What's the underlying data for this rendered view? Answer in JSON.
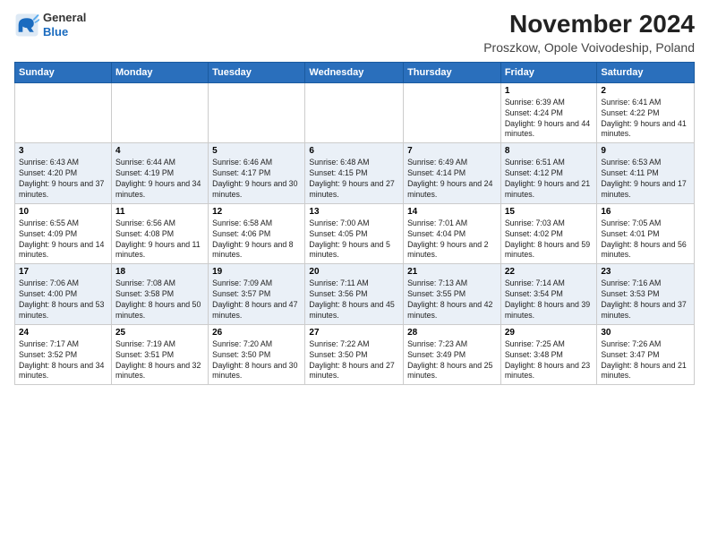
{
  "header": {
    "logo": {
      "line1": "General",
      "line2": "Blue"
    },
    "title": "November 2024",
    "subtitle": "Proszkow, Opole Voivodeship, Poland"
  },
  "days_of_week": [
    "Sunday",
    "Monday",
    "Tuesday",
    "Wednesday",
    "Thursday",
    "Friday",
    "Saturday"
  ],
  "weeks": [
    {
      "days": [
        {
          "num": "",
          "info": ""
        },
        {
          "num": "",
          "info": ""
        },
        {
          "num": "",
          "info": ""
        },
        {
          "num": "",
          "info": ""
        },
        {
          "num": "",
          "info": ""
        },
        {
          "num": "1",
          "info": "Sunrise: 6:39 AM\nSunset: 4:24 PM\nDaylight: 9 hours and 44 minutes."
        },
        {
          "num": "2",
          "info": "Sunrise: 6:41 AM\nSunset: 4:22 PM\nDaylight: 9 hours and 41 minutes."
        }
      ]
    },
    {
      "days": [
        {
          "num": "3",
          "info": "Sunrise: 6:43 AM\nSunset: 4:20 PM\nDaylight: 9 hours and 37 minutes."
        },
        {
          "num": "4",
          "info": "Sunrise: 6:44 AM\nSunset: 4:19 PM\nDaylight: 9 hours and 34 minutes."
        },
        {
          "num": "5",
          "info": "Sunrise: 6:46 AM\nSunset: 4:17 PM\nDaylight: 9 hours and 30 minutes."
        },
        {
          "num": "6",
          "info": "Sunrise: 6:48 AM\nSunset: 4:15 PM\nDaylight: 9 hours and 27 minutes."
        },
        {
          "num": "7",
          "info": "Sunrise: 6:49 AM\nSunset: 4:14 PM\nDaylight: 9 hours and 24 minutes."
        },
        {
          "num": "8",
          "info": "Sunrise: 6:51 AM\nSunset: 4:12 PM\nDaylight: 9 hours and 21 minutes."
        },
        {
          "num": "9",
          "info": "Sunrise: 6:53 AM\nSunset: 4:11 PM\nDaylight: 9 hours and 17 minutes."
        }
      ]
    },
    {
      "days": [
        {
          "num": "10",
          "info": "Sunrise: 6:55 AM\nSunset: 4:09 PM\nDaylight: 9 hours and 14 minutes."
        },
        {
          "num": "11",
          "info": "Sunrise: 6:56 AM\nSunset: 4:08 PM\nDaylight: 9 hours and 11 minutes."
        },
        {
          "num": "12",
          "info": "Sunrise: 6:58 AM\nSunset: 4:06 PM\nDaylight: 9 hours and 8 minutes."
        },
        {
          "num": "13",
          "info": "Sunrise: 7:00 AM\nSunset: 4:05 PM\nDaylight: 9 hours and 5 minutes."
        },
        {
          "num": "14",
          "info": "Sunrise: 7:01 AM\nSunset: 4:04 PM\nDaylight: 9 hours and 2 minutes."
        },
        {
          "num": "15",
          "info": "Sunrise: 7:03 AM\nSunset: 4:02 PM\nDaylight: 8 hours and 59 minutes."
        },
        {
          "num": "16",
          "info": "Sunrise: 7:05 AM\nSunset: 4:01 PM\nDaylight: 8 hours and 56 minutes."
        }
      ]
    },
    {
      "days": [
        {
          "num": "17",
          "info": "Sunrise: 7:06 AM\nSunset: 4:00 PM\nDaylight: 8 hours and 53 minutes."
        },
        {
          "num": "18",
          "info": "Sunrise: 7:08 AM\nSunset: 3:58 PM\nDaylight: 8 hours and 50 minutes."
        },
        {
          "num": "19",
          "info": "Sunrise: 7:09 AM\nSunset: 3:57 PM\nDaylight: 8 hours and 47 minutes."
        },
        {
          "num": "20",
          "info": "Sunrise: 7:11 AM\nSunset: 3:56 PM\nDaylight: 8 hours and 45 minutes."
        },
        {
          "num": "21",
          "info": "Sunrise: 7:13 AM\nSunset: 3:55 PM\nDaylight: 8 hours and 42 minutes."
        },
        {
          "num": "22",
          "info": "Sunrise: 7:14 AM\nSunset: 3:54 PM\nDaylight: 8 hours and 39 minutes."
        },
        {
          "num": "23",
          "info": "Sunrise: 7:16 AM\nSunset: 3:53 PM\nDaylight: 8 hours and 37 minutes."
        }
      ]
    },
    {
      "days": [
        {
          "num": "24",
          "info": "Sunrise: 7:17 AM\nSunset: 3:52 PM\nDaylight: 8 hours and 34 minutes."
        },
        {
          "num": "25",
          "info": "Sunrise: 7:19 AM\nSunset: 3:51 PM\nDaylight: 8 hours and 32 minutes."
        },
        {
          "num": "26",
          "info": "Sunrise: 7:20 AM\nSunset: 3:50 PM\nDaylight: 8 hours and 30 minutes."
        },
        {
          "num": "27",
          "info": "Sunrise: 7:22 AM\nSunset: 3:50 PM\nDaylight: 8 hours and 27 minutes."
        },
        {
          "num": "28",
          "info": "Sunrise: 7:23 AM\nSunset: 3:49 PM\nDaylight: 8 hours and 25 minutes."
        },
        {
          "num": "29",
          "info": "Sunrise: 7:25 AM\nSunset: 3:48 PM\nDaylight: 8 hours and 23 minutes."
        },
        {
          "num": "30",
          "info": "Sunrise: 7:26 AM\nSunset: 3:47 PM\nDaylight: 8 hours and 21 minutes."
        }
      ]
    }
  ]
}
